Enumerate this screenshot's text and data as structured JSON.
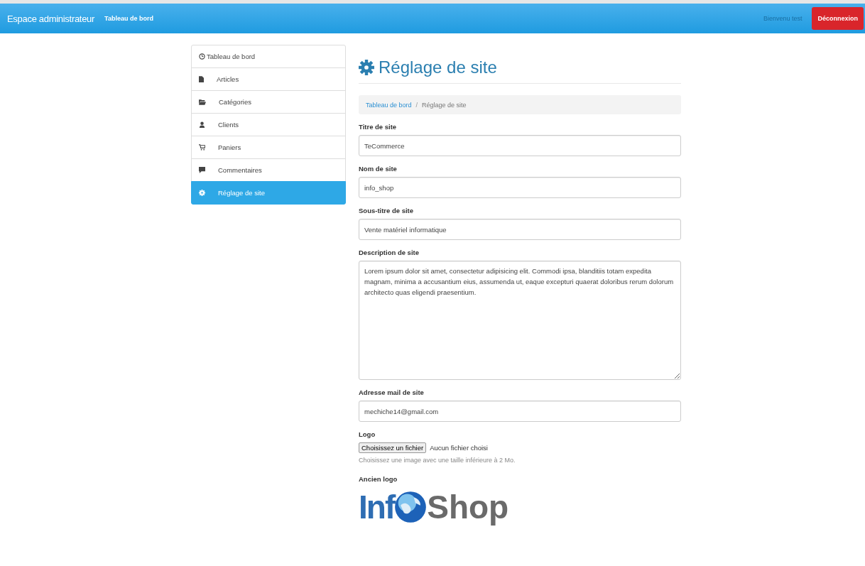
{
  "navbar": {
    "brand": "Espace administrateur",
    "link": "Tableau de bord",
    "welcome": "Bienvenu test",
    "logout": "Déconnexion"
  },
  "sidebar": {
    "items": [
      {
        "label": "Tableau de bord",
        "selected": false
      },
      {
        "label": "Articles",
        "selected": false
      },
      {
        "label": "Catégories",
        "selected": false
      },
      {
        "label": "Clients",
        "selected": false
      },
      {
        "label": "Paniers",
        "selected": false
      },
      {
        "label": "Commentaires",
        "selected": false
      },
      {
        "label": "Réglage de site",
        "selected": true
      }
    ]
  },
  "page_title": "Réglage de site",
  "breadcrumb_separator": "/",
  "breadcrumb": [
    {
      "label": "Tableau de bord",
      "selected": false
    },
    {
      "label": "Réglage de site",
      "selected": true
    }
  ],
  "fields": [
    {
      "kind": "input",
      "label": "Titre de site",
      "value": "TeCommerce"
    },
    {
      "kind": "input",
      "label": "Nom de site",
      "value": "info_shop"
    },
    {
      "kind": "input",
      "label": "Sous-titre de site",
      "value": "Vente matériel informatique"
    },
    {
      "kind": "textarea",
      "label": "Description de site",
      "value": "Lorem ipsum dolor sit amet, consectetur adipisicing elit. Commodi ipsa, blanditiis totam expedita magnam, minima a accusantium eius, assumenda ut, eaque excepturi quaerat doloribus rerum dolorum architecto quas eligendi praesentium."
    },
    {
      "kind": "input",
      "label": "Adresse mail de site",
      "value": "mechiche14@gmail.com"
    }
  ],
  "logo": {
    "label": "Logo",
    "button": "Choisissez un fichier",
    "status": "Aucun fichier choisi",
    "help": "Choisissez une image avec une taille inférieure à 2 Mo."
  },
  "old_logo": {
    "label": "Ancien logo",
    "text_left": "Inf",
    "text_right": "Shop"
  }
}
